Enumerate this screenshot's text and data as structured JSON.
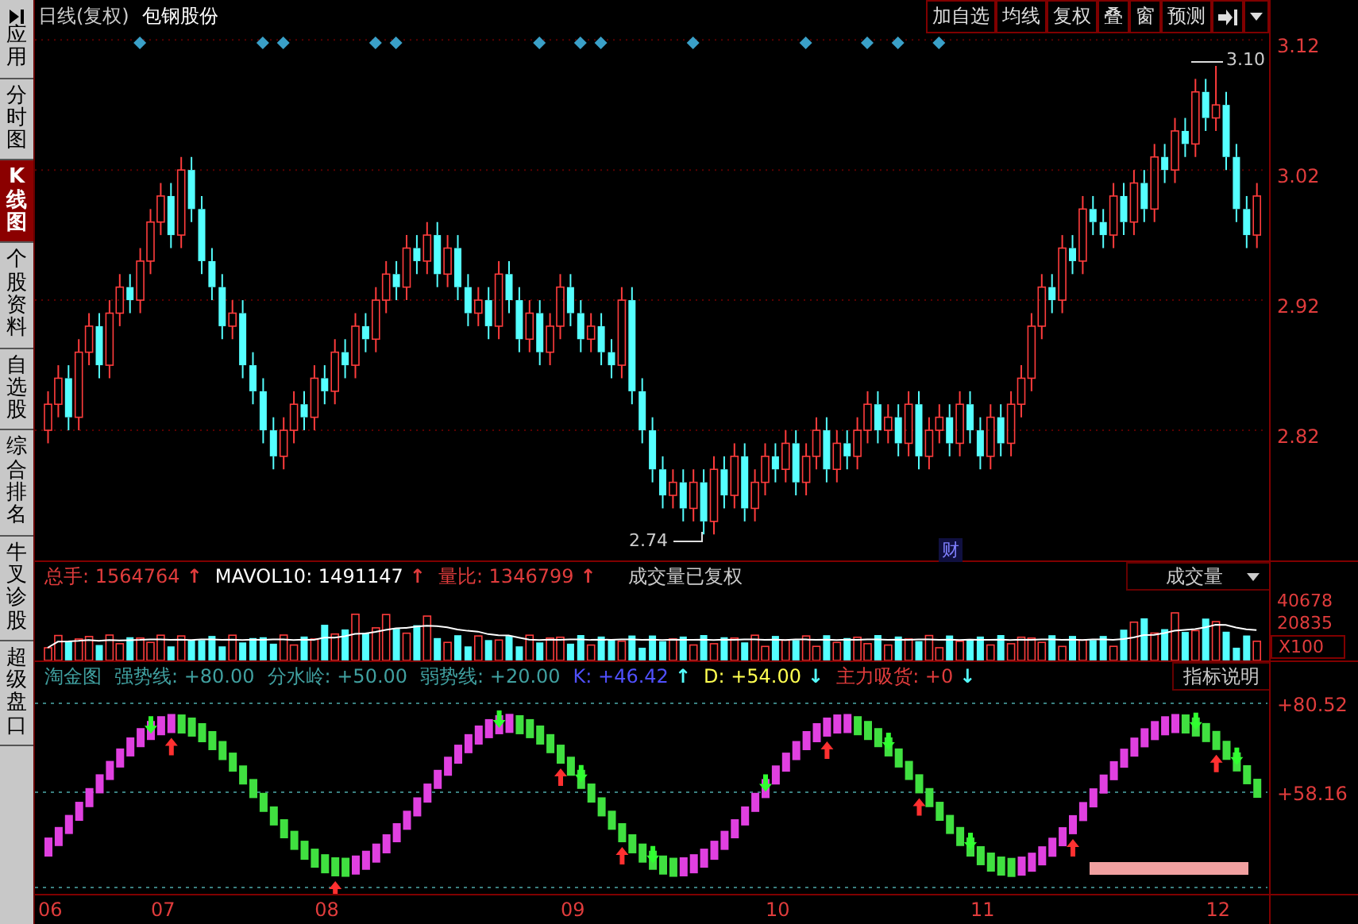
{
  "sidebar": {
    "items": [
      {
        "label": "应用",
        "selected": false
      },
      {
        "label": "分时图",
        "selected": false
      },
      {
        "label": "K线图",
        "selected": true
      },
      {
        "label": "个股资料",
        "selected": false
      },
      {
        "label": "自选股",
        "selected": false
      },
      {
        "label": "综合排名",
        "selected": false
      },
      {
        "label": "牛叉诊股",
        "selected": false
      },
      {
        "label": "超级盘口",
        "selected": false
      }
    ]
  },
  "header": {
    "period": "日线(复权)",
    "stock": "包钢股份",
    "buttons": [
      "加自选",
      "均线",
      "复权",
      "叠",
      "窗",
      "预测"
    ]
  },
  "price_chart": {
    "high_label": "3.10",
    "low_label": "2.74",
    "marker": "财",
    "chart_data": {
      "type": "candlestick",
      "ylim": [
        2.72,
        3.125
      ],
      "yticks": [
        2.82,
        2.92,
        3.02,
        3.12
      ],
      "grid": true,
      "ohlc": [
        [
          2.82,
          2.85,
          2.81,
          2.84
        ],
        [
          2.84,
          2.87,
          2.83,
          2.86
        ],
        [
          2.86,
          2.87,
          2.82,
          2.83
        ],
        [
          2.83,
          2.89,
          2.82,
          2.88
        ],
        [
          2.88,
          2.91,
          2.87,
          2.9
        ],
        [
          2.9,
          2.91,
          2.86,
          2.87
        ],
        [
          2.87,
          2.92,
          2.86,
          2.91
        ],
        [
          2.91,
          2.94,
          2.9,
          2.93
        ],
        [
          2.93,
          2.94,
          2.91,
          2.92
        ],
        [
          2.92,
          2.96,
          2.91,
          2.95
        ],
        [
          2.95,
          2.99,
          2.94,
          2.98
        ],
        [
          2.98,
          3.01,
          2.97,
          3.0
        ],
        [
          3.0,
          3.01,
          2.96,
          2.97
        ],
        [
          2.97,
          3.03,
          2.96,
          3.02
        ],
        [
          3.02,
          3.03,
          2.98,
          2.99
        ],
        [
          2.99,
          3.0,
          2.94,
          2.95
        ],
        [
          2.95,
          2.96,
          2.92,
          2.93
        ],
        [
          2.93,
          2.94,
          2.89,
          2.9
        ],
        [
          2.9,
          2.92,
          2.89,
          2.91
        ],
        [
          2.91,
          2.92,
          2.86,
          2.87
        ],
        [
          2.87,
          2.88,
          2.84,
          2.85
        ],
        [
          2.85,
          2.86,
          2.81,
          2.82
        ],
        [
          2.82,
          2.83,
          2.79,
          2.8
        ],
        [
          2.8,
          2.83,
          2.79,
          2.82
        ],
        [
          2.82,
          2.85,
          2.81,
          2.84
        ],
        [
          2.84,
          2.85,
          2.82,
          2.83
        ],
        [
          2.83,
          2.87,
          2.82,
          2.86
        ],
        [
          2.86,
          2.87,
          2.84,
          2.85
        ],
        [
          2.85,
          2.89,
          2.84,
          2.88
        ],
        [
          2.88,
          2.89,
          2.86,
          2.87
        ],
        [
          2.87,
          2.91,
          2.86,
          2.9
        ],
        [
          2.9,
          2.91,
          2.88,
          2.89
        ],
        [
          2.89,
          2.93,
          2.88,
          2.92
        ],
        [
          2.92,
          2.95,
          2.91,
          2.94
        ],
        [
          2.94,
          2.95,
          2.92,
          2.93
        ],
        [
          2.93,
          2.97,
          2.92,
          2.96
        ],
        [
          2.96,
          2.97,
          2.94,
          2.95
        ],
        [
          2.95,
          2.98,
          2.94,
          2.97
        ],
        [
          2.97,
          2.98,
          2.93,
          2.94
        ],
        [
          2.94,
          2.97,
          2.93,
          2.96
        ],
        [
          2.96,
          2.97,
          2.92,
          2.93
        ],
        [
          2.93,
          2.94,
          2.9,
          2.91
        ],
        [
          2.91,
          2.93,
          2.9,
          2.92
        ],
        [
          2.92,
          2.93,
          2.89,
          2.9
        ],
        [
          2.9,
          2.95,
          2.89,
          2.94
        ],
        [
          2.94,
          2.95,
          2.91,
          2.92
        ],
        [
          2.92,
          2.93,
          2.88,
          2.89
        ],
        [
          2.89,
          2.92,
          2.88,
          2.91
        ],
        [
          2.91,
          2.92,
          2.87,
          2.88
        ],
        [
          2.88,
          2.91,
          2.87,
          2.9
        ],
        [
          2.9,
          2.94,
          2.89,
          2.93
        ],
        [
          2.93,
          2.94,
          2.9,
          2.91
        ],
        [
          2.91,
          2.92,
          2.88,
          2.89
        ],
        [
          2.89,
          2.91,
          2.88,
          2.9
        ],
        [
          2.9,
          2.91,
          2.87,
          2.88
        ],
        [
          2.88,
          2.89,
          2.86,
          2.87
        ],
        [
          2.87,
          2.93,
          2.86,
          2.92
        ],
        [
          2.92,
          2.93,
          2.84,
          2.85
        ],
        [
          2.85,
          2.86,
          2.81,
          2.82
        ],
        [
          2.82,
          2.83,
          2.78,
          2.79
        ],
        [
          2.79,
          2.8,
          2.76,
          2.77
        ],
        [
          2.77,
          2.79,
          2.76,
          2.78
        ],
        [
          2.78,
          2.79,
          2.75,
          2.76
        ],
        [
          2.76,
          2.79,
          2.75,
          2.78
        ],
        [
          2.78,
          2.79,
          2.74,
          2.75
        ],
        [
          2.75,
          2.8,
          2.74,
          2.79
        ],
        [
          2.79,
          2.8,
          2.76,
          2.77
        ],
        [
          2.77,
          2.81,
          2.76,
          2.8
        ],
        [
          2.8,
          2.81,
          2.75,
          2.76
        ],
        [
          2.76,
          2.79,
          2.75,
          2.78
        ],
        [
          2.78,
          2.81,
          2.77,
          2.8
        ],
        [
          2.8,
          2.81,
          2.78,
          2.79
        ],
        [
          2.79,
          2.82,
          2.78,
          2.81
        ],
        [
          2.81,
          2.82,
          2.77,
          2.78
        ],
        [
          2.78,
          2.81,
          2.77,
          2.8
        ],
        [
          2.8,
          2.83,
          2.79,
          2.82
        ],
        [
          2.82,
          2.83,
          2.78,
          2.79
        ],
        [
          2.79,
          2.82,
          2.78,
          2.81
        ],
        [
          2.81,
          2.82,
          2.79,
          2.8
        ],
        [
          2.8,
          2.83,
          2.79,
          2.82
        ],
        [
          2.82,
          2.85,
          2.81,
          2.84
        ],
        [
          2.84,
          2.85,
          2.81,
          2.82
        ],
        [
          2.82,
          2.84,
          2.81,
          2.83
        ],
        [
          2.83,
          2.84,
          2.8,
          2.81
        ],
        [
          2.81,
          2.85,
          2.8,
          2.84
        ],
        [
          2.84,
          2.85,
          2.79,
          2.8
        ],
        [
          2.8,
          2.83,
          2.79,
          2.82
        ],
        [
          2.82,
          2.84,
          2.81,
          2.83
        ],
        [
          2.83,
          2.84,
          2.8,
          2.81
        ],
        [
          2.81,
          2.85,
          2.8,
          2.84
        ],
        [
          2.84,
          2.85,
          2.81,
          2.82
        ],
        [
          2.82,
          2.83,
          2.79,
          2.8
        ],
        [
          2.8,
          2.84,
          2.79,
          2.83
        ],
        [
          2.83,
          2.84,
          2.8,
          2.81
        ],
        [
          2.81,
          2.85,
          2.8,
          2.84
        ],
        [
          2.84,
          2.87,
          2.83,
          2.86
        ],
        [
          2.86,
          2.91,
          2.85,
          2.9
        ],
        [
          2.9,
          2.94,
          2.89,
          2.93
        ],
        [
          2.93,
          2.94,
          2.91,
          2.92
        ],
        [
          2.92,
          2.97,
          2.91,
          2.96
        ],
        [
          2.96,
          2.97,
          2.94,
          2.95
        ],
        [
          2.95,
          3.0,
          2.94,
          2.99
        ],
        [
          2.99,
          3.0,
          2.97,
          2.98
        ],
        [
          2.98,
          2.99,
          2.96,
          2.97
        ],
        [
          2.97,
          3.01,
          2.96,
          3.0
        ],
        [
          3.0,
          3.01,
          2.97,
          2.98
        ],
        [
          2.98,
          3.02,
          2.97,
          3.01
        ],
        [
          3.01,
          3.02,
          2.98,
          2.99
        ],
        [
          2.99,
          3.04,
          2.98,
          3.03
        ],
        [
          3.03,
          3.04,
          3.01,
          3.02
        ],
        [
          3.02,
          3.06,
          3.01,
          3.05
        ],
        [
          3.05,
          3.06,
          3.03,
          3.04
        ],
        [
          3.04,
          3.09,
          3.03,
          3.08
        ],
        [
          3.08,
          3.09,
          3.05,
          3.06
        ],
        [
          3.06,
          3.1,
          3.05,
          3.07
        ],
        [
          3.07,
          3.08,
          3.02,
          3.03
        ],
        [
          3.03,
          3.04,
          2.98,
          2.99
        ],
        [
          2.99,
          3.0,
          2.96,
          2.97
        ],
        [
          2.97,
          3.01,
          2.96,
          3.0
        ]
      ]
    }
  },
  "volume_panel": {
    "stats": [
      {
        "label": "总手:",
        "value": "1564764",
        "arrow": "↑",
        "color": "#e03c3c"
      },
      {
        "label": "MAVOL10:",
        "value": "1491147",
        "arrow": "↑",
        "color": "#ffffff"
      },
      {
        "label": "量比:",
        "value": "1346799",
        "arrow": "↑",
        "color": "#e03c3c"
      }
    ],
    "note": "成交量已复权",
    "selector": "成交量",
    "axis_labels": [
      "40678",
      "20835",
      "X100"
    ]
  },
  "indicator_panel": {
    "name": "淘金图",
    "stats": [
      {
        "label": "强势线:",
        "value": "+80.00",
        "color": "#40a0a0"
      },
      {
        "label": "分水岭:",
        "value": "+50.00",
        "color": "#40a0a0"
      },
      {
        "label": "弱势线:",
        "value": "+20.00",
        "color": "#40a0a0"
      },
      {
        "label": "K:",
        "value": "+46.42",
        "arrow": "↑",
        "color": "#5050ff"
      },
      {
        "label": "D:",
        "value": "+54.00",
        "arrow": "↓",
        "color": "#ffff50"
      },
      {
        "label": "主力吸货:",
        "value": "+0",
        "arrow": "↓",
        "color": "#e03c3c"
      }
    ],
    "help_button": "指标说明",
    "axis_labels": [
      "+80.52",
      "+58.16"
    ]
  },
  "time_axis": [
    "06",
    "07",
    "08",
    "09",
    "10",
    "11",
    "12"
  ]
}
